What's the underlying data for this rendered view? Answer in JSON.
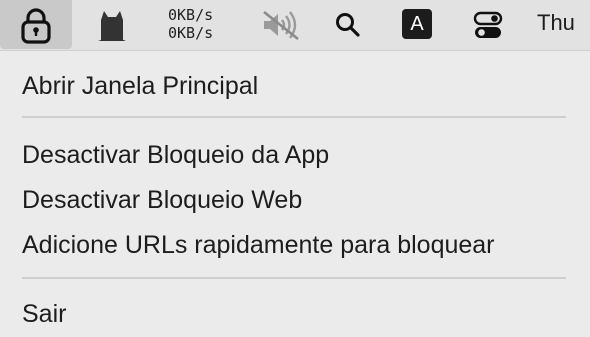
{
  "menubar": {
    "network_up": "0KB/s",
    "network_down": "0KB/s",
    "input_source": "A",
    "clock_day": "Thu",
    "icons": [
      "lock-icon",
      "cat-icon",
      "speaker-muted-icon",
      "search-icon",
      "input-source-icon",
      "control-center-icon"
    ]
  },
  "menu": {
    "items": [
      {
        "label": "Abrir Janela Principal"
      },
      {
        "label": "Desactivar Bloqueio da App"
      },
      {
        "label": "Desactivar Bloqueio Web"
      },
      {
        "label": "Adicione URLs rapidamente para bloquear"
      },
      {
        "label": "Sair"
      }
    ]
  },
  "colors": {
    "menubar_bg": "#e2e2e2",
    "menu_bg": "#ebebeb",
    "highlight_bg": "#c9c9c9",
    "separator": "#cfcfcf"
  }
}
